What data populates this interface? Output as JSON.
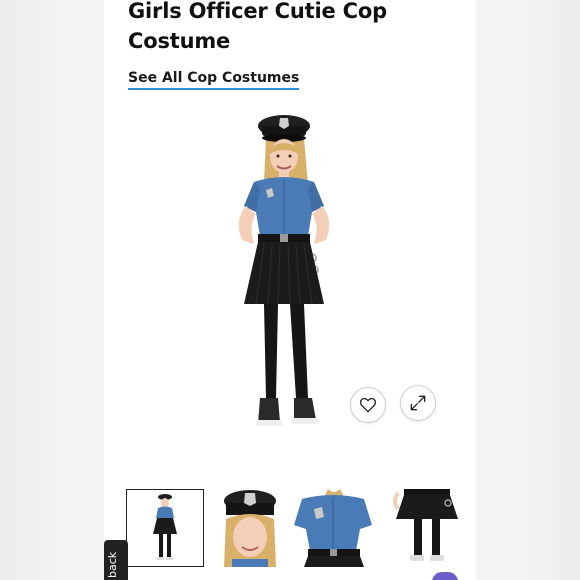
{
  "product": {
    "title": "Girls Officer Cutie Cop Costume",
    "see_all_link": "See All Cop Costumes"
  },
  "actions": {
    "favorite_icon": "heart-outline-icon",
    "zoom_icon": "expand-arrows-icon"
  },
  "thumbnails": [
    {
      "view": "full-body",
      "selected": true
    },
    {
      "view": "hat-and-face",
      "selected": false
    },
    {
      "view": "shirt-and-belt",
      "selected": false
    },
    {
      "view": "skirt-and-legs",
      "selected": false
    }
  ],
  "feedback": {
    "label": "back"
  },
  "colors": {
    "link_underline": "#2f8fd6",
    "shirt_blue": "#4a7bb6",
    "skirt_black": "#1b1b1b",
    "badge_silver": "#c9c9c9",
    "chat_accent": "#6b5fc7"
  }
}
